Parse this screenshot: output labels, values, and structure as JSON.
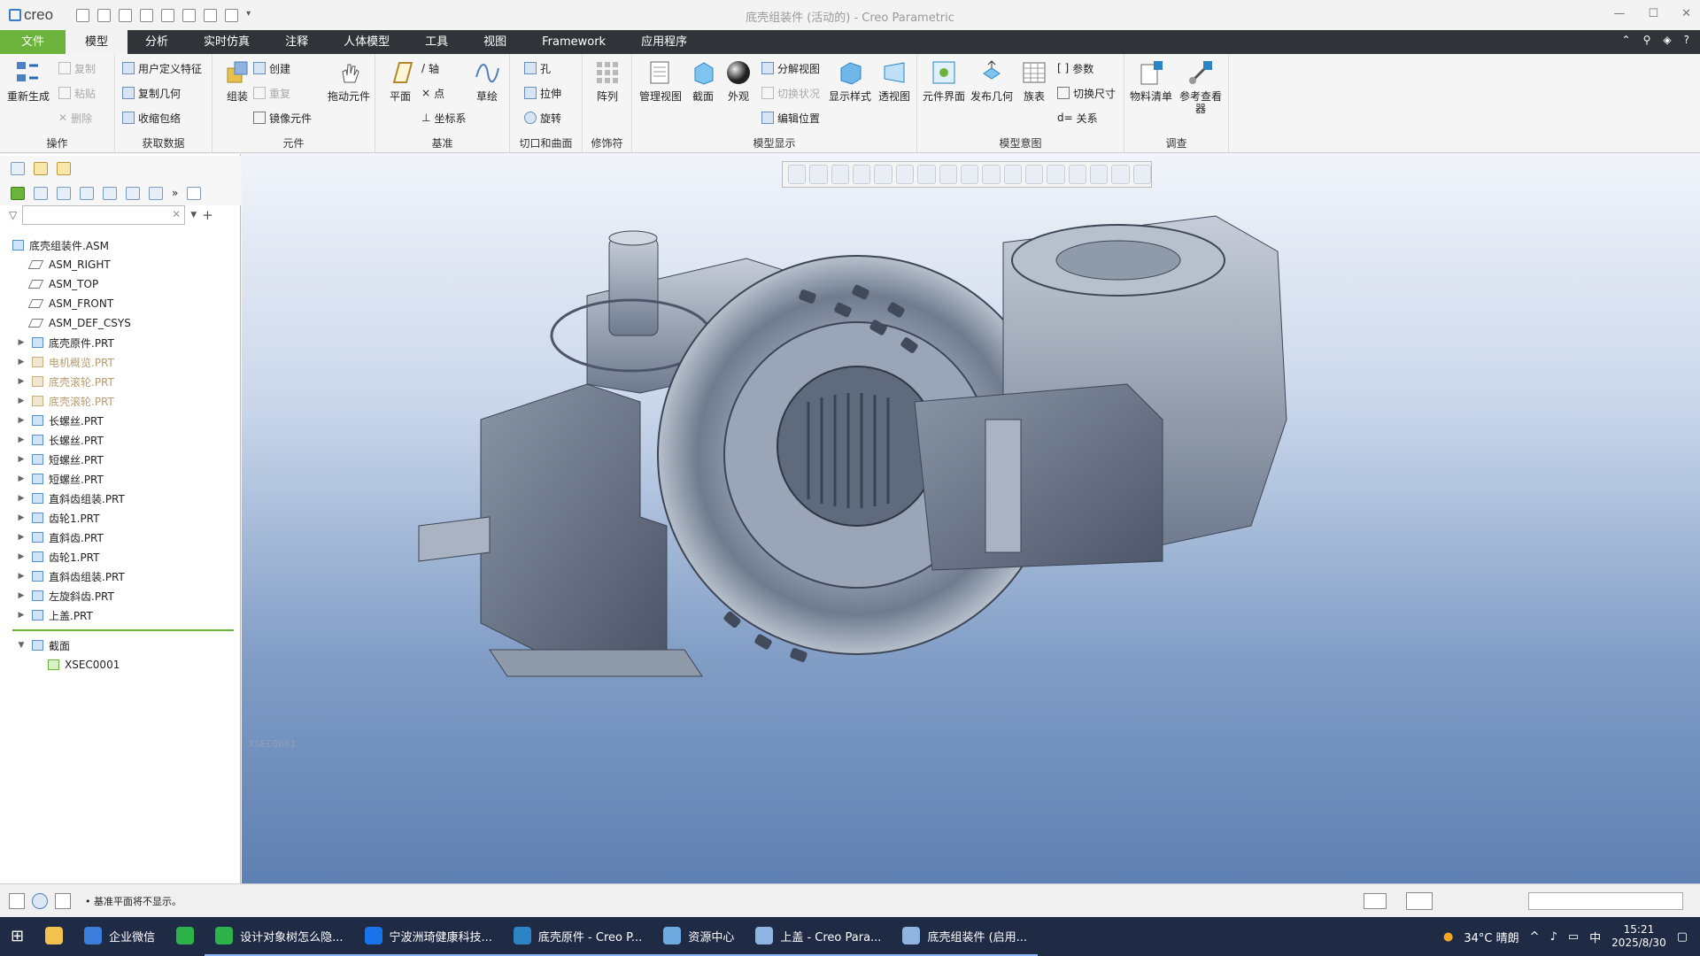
{
  "app": {
    "logo": "creo",
    "window_title": "底壳组装件 (活动的) - Creo Parametric",
    "minimize": "—",
    "maximize": "☐",
    "close": "✕"
  },
  "tabs": [
    "文件",
    "模型",
    "分析",
    "实时仿真",
    "注释",
    "人体模型",
    "工具",
    "视图",
    "Framework",
    "应用程序"
  ],
  "ribbon": {
    "operations": {
      "label": "操作",
      "regen": "重新生成",
      "copy": "复制",
      "paste": "粘贴",
      "delete": "删除"
    },
    "getdata": {
      "label": "获取数据",
      "udf": "用户定义特征",
      "copygeom": "复制几何",
      "shrinkwrap": "收缩包络"
    },
    "component": {
      "label": "元件",
      "assemble": "组装",
      "create": "创建",
      "repeat": "重复",
      "mirror": "镜像元件",
      "drag": "拖动元件"
    },
    "datum": {
      "label": "基准",
      "plane": "平面",
      "axis": "轴",
      "point": "点",
      "csys": "坐标系",
      "sketch": "草绘"
    },
    "cut": {
      "label": "切口和曲面",
      "hole": "孔",
      "extrude": "拉伸",
      "revolve": "旋转"
    },
    "modifier": {
      "label": "修饰符",
      "pattern": "阵列"
    },
    "modeldisplay": {
      "label": "模型显示",
      "manage": "管理视图",
      "section": "截面",
      "appearance": "外观",
      "explode": "分解视图",
      "toggle": "切换状况",
      "editpos": "编辑位置",
      "displaystyle": "显示样式",
      "perspective": "透视图"
    },
    "intent": {
      "label": "模型意图",
      "interface": "元件界面",
      "publish": "发布几何",
      "family": "族表",
      "params": "参数",
      "switchdim": "切换尺寸",
      "relations": "关系"
    },
    "investigate": {
      "label": "调查",
      "bom": "物料清单",
      "refviewer": "参考查看器"
    }
  },
  "tree": {
    "search_placeholder": "",
    "root": "底壳组装件.ASM",
    "datums": [
      "ASM_RIGHT",
      "ASM_TOP",
      "ASM_FRONT",
      "ASM_DEF_CSYS"
    ],
    "parts": [
      {
        "name": "底壳原件.PRT",
        "dim": false
      },
      {
        "name": "电机概览.PRT",
        "dim": true
      },
      {
        "name": "底壳滚轮.PRT",
        "dim": true
      },
      {
        "name": "底壳滚轮.PRT",
        "dim": true
      },
      {
        "name": "长螺丝.PRT",
        "dim": false
      },
      {
        "name": "长螺丝.PRT",
        "dim": false
      },
      {
        "name": "短螺丝.PRT",
        "dim": false
      },
      {
        "name": "短螺丝.PRT",
        "dim": false
      },
      {
        "name": "直斜齿组装.PRT",
        "dim": false
      },
      {
        "name": "齿轮1.PRT",
        "dim": false
      },
      {
        "name": "直斜齿.PRT",
        "dim": false
      },
      {
        "name": "齿轮1.PRT",
        "dim": false
      },
      {
        "name": "直斜齿组装.PRT",
        "dim": false
      },
      {
        "name": "左旋斜齿.PRT",
        "dim": false
      },
      {
        "name": "上盖.PRT",
        "dim": false
      }
    ],
    "sections_label": "截面",
    "section_item": "XSEC0001"
  },
  "viewport": {
    "watermark": "XSEC0001"
  },
  "status": {
    "message": "基准平面将不显示。"
  },
  "taskbar": {
    "items": [
      "企业微信",
      "设计对象树怎么隐...",
      "宁波洲琦健康科技...",
      "底壳原件 - Creo P...",
      "资源中心",
      "上盖 - Creo Para...",
      "底壳组装件 (启用..."
    ],
    "weather": "34°C 晴朗",
    "ime": "中",
    "time": "15:21",
    "date": "2025/8/30"
  }
}
